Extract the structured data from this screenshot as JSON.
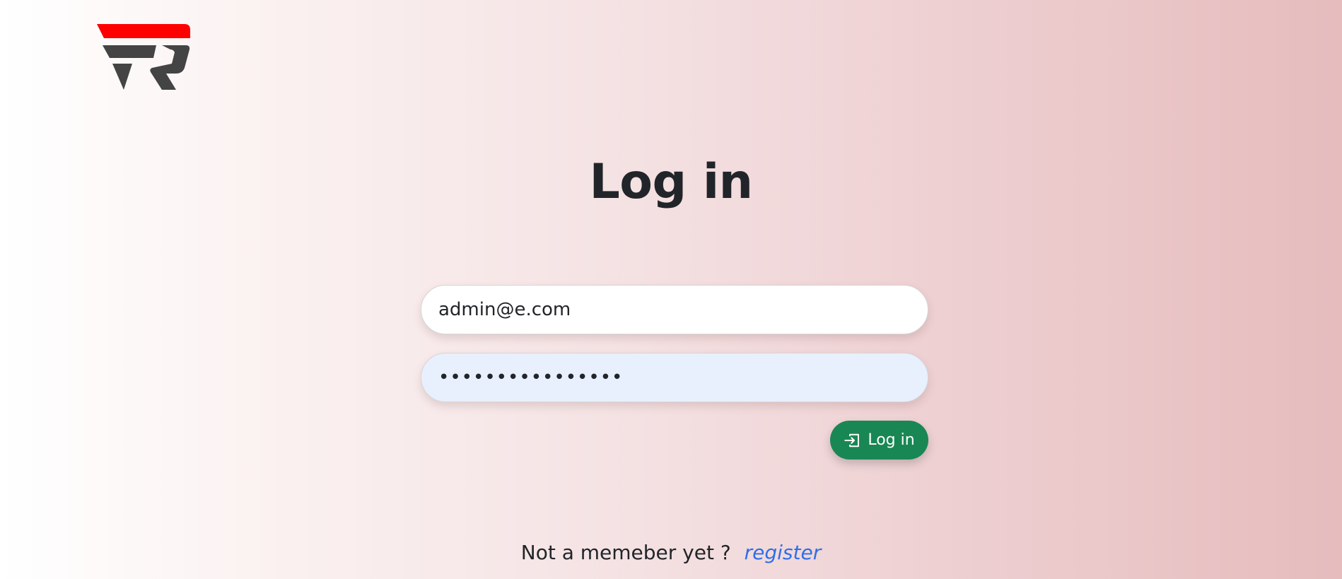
{
  "logo": {
    "icon": "fr-logo-icon",
    "colors": {
      "accent": "#ff0000",
      "dark": "#444444"
    }
  },
  "page_title": "Log in",
  "form": {
    "email_value": "admin@e.com",
    "password_value": "••••••••••••••••",
    "login_button_label": "Log in",
    "login_button_icon": "box-arrow-in-right-icon",
    "login_button_color": "#198754"
  },
  "footer": {
    "prompt_text": "Not a memeber yet ?",
    "register_link_text": "register",
    "link_color": "#2f6fe8"
  }
}
